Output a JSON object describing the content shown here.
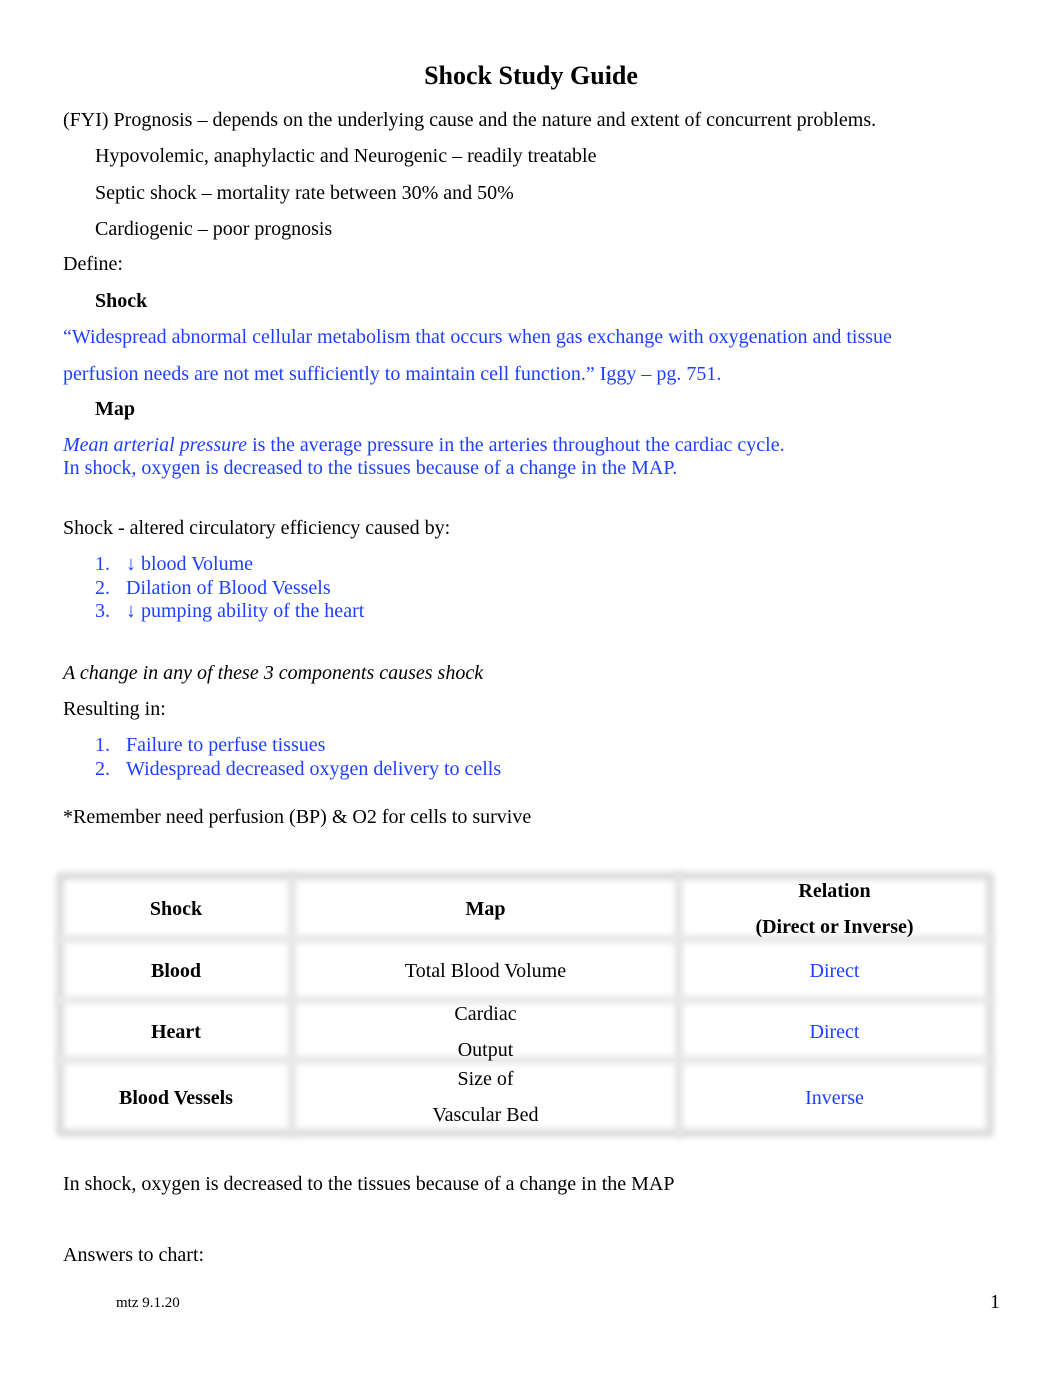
{
  "title": "Shock Study Guide",
  "prognosis": {
    "intro": "(FYI) Prognosis – depends on the underlying cause and the nature and extent of concurrent problems.",
    "items": [
      "Hypovolemic, anaphylactic and Neurogenic – readily treatable",
      "Septic shock – mortality rate between 30% and 50%",
      "Cardiogenic – poor prognosis"
    ]
  },
  "define": {
    "label": "Define:",
    "shock_heading": "Shock",
    "shock_def_line1": "“Widespread abnormal cellular metabolism that occurs when gas exchange with oxygenation and tissue",
    "shock_def_line2": "perfusion needs are not met sufficiently to maintain cell function.” Iggy – pg. 751.",
    "map_heading": "Map",
    "map_def_italic": "Mean arterial pressure",
    "map_def_rest": " is the average pressure in the arteries throughout the cardiac cycle.",
    "map_def_line2": "In shock, oxygen is decreased to the tissues because of a change in the MAP."
  },
  "causes": {
    "intro": "Shock - altered circulatory efficiency caused by:",
    "items": [
      {
        "num": "1.",
        "text": "↓ blood Volume"
      },
      {
        "num": "2.",
        "text": "Dilation of Blood Vessels"
      },
      {
        "num": "3.",
        "text": "↓ pumping ability of the heart"
      }
    ]
  },
  "change_note": "A change in any of these 3 components causes shock",
  "resulting": {
    "intro": "Resulting in:",
    "items": [
      {
        "num": "1.",
        "text": "Failure to perfuse tissues"
      },
      {
        "num": "2.",
        "text": "Widespread decreased oxygen delivery to cells"
      }
    ]
  },
  "remember": "*Remember need perfusion (BP) & O2 for cells to survive",
  "table": {
    "headers": {
      "col1": "Shock",
      "col2": "Map",
      "col3_line1": "Relation",
      "col3_line2": "(Direct or Inverse)"
    },
    "rows": [
      {
        "shock": "Blood",
        "map_line1": "Total Blood Volume",
        "map_line2": "",
        "relation": "Direct"
      },
      {
        "shock": "Heart",
        "map_line1": "Cardiac",
        "map_line2": "Output",
        "relation": "Direct"
      },
      {
        "shock": "Blood Vessels",
        "map_line1": "Size of",
        "map_line2": "Vascular Bed",
        "relation": "Inverse"
      }
    ]
  },
  "after_table": "In shock, oxygen is decreased to the tissues because of a change in the MAP",
  "answers_label": "Answers to chart:",
  "footer": {
    "left": "mtz 9.1.20",
    "page_number": "1"
  },
  "colors": {
    "answer_blue": "#1f3fff",
    "table_border": "#dcdcdc"
  }
}
